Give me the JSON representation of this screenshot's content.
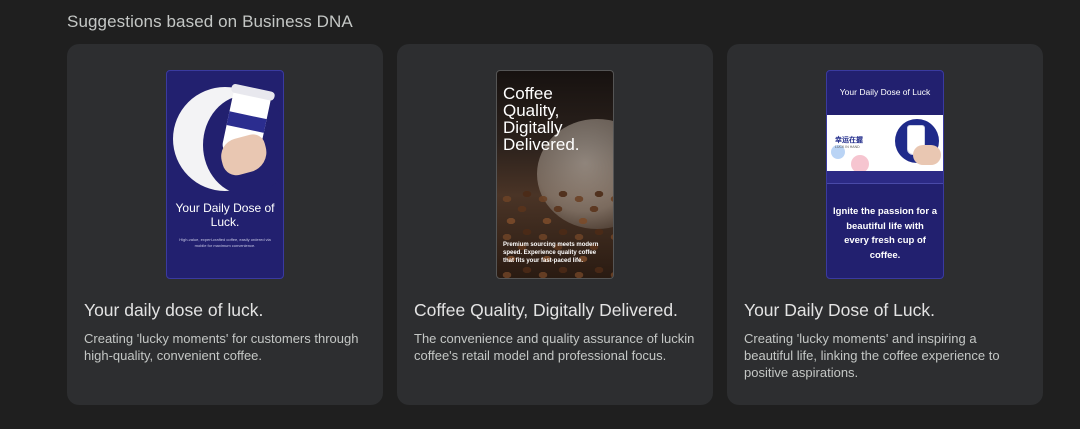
{
  "section": {
    "title": "Suggestions based on Business DNA"
  },
  "cards": [
    {
      "thumb": {
        "title": "Your Daily Dose of Luck.",
        "small": "High-value, expert-crafted coffee, easily ordered via mobile for maximum convenience."
      },
      "headline": "Your daily dose of luck.",
      "description": "Creating 'lucky moments' for customers through high-quality, convenient coffee."
    },
    {
      "thumb": {
        "title": "Coffee Quality, Digitally Delivered.",
        "small": "Premium sourcing meets modern speed. Experience quality coffee that fits your fast-paced life."
      },
      "headline": "Coffee Quality, Digitally Delivered.",
      "description": "The convenience and quality assurance of luckin coffee's retail model and professional focus."
    },
    {
      "thumb": {
        "title": "Your Daily Dose of Luck",
        "brand": "幸运在握",
        "brand_small": "LUCK IN HAND",
        "body": "Ignite the passion for a beautiful life with every fresh cup of coffee."
      },
      "headline": "Your Daily Dose of Luck.",
      "description": "Creating 'lucky moments' and inspiring a beautiful life, linking the coffee experience to positive aspirations."
    }
  ]
}
